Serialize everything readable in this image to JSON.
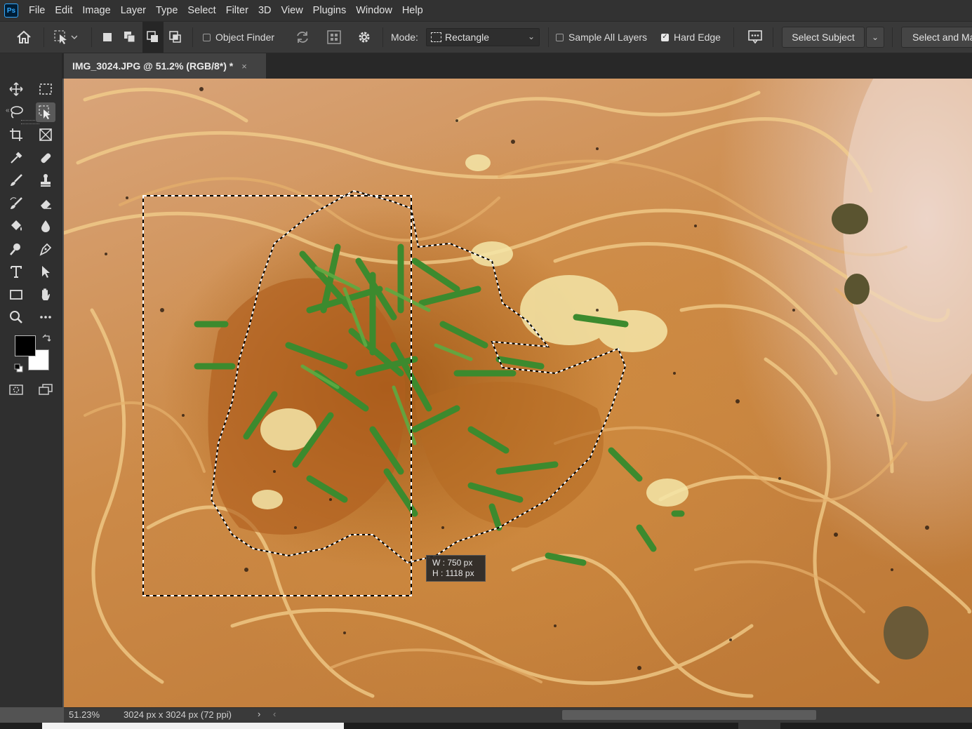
{
  "app": {
    "logo_text": "Ps",
    "menu": [
      "File",
      "Edit",
      "Image",
      "Layer",
      "Type",
      "Select",
      "Filter",
      "3D",
      "View",
      "Plugins",
      "Window",
      "Help"
    ]
  },
  "options_bar": {
    "object_finder": {
      "label": "Object Finder",
      "checked": false
    },
    "mode_label": "Mode:",
    "mode_value": "Rectangle",
    "sample_all_layers": {
      "label": "Sample All Layers",
      "checked": false
    },
    "hard_edge": {
      "label": "Hard Edge",
      "checked": true
    },
    "select_subject_label": "Select Subject",
    "select_and_mask_label": "Select and Ma"
  },
  "document": {
    "tab_title": "IMG_3024.JPG @ 51.2% (RGB/8*) *",
    "close_glyph": "×"
  },
  "selection_hint": {
    "width": "W :   750 px",
    "height": "H : 1118 px"
  },
  "status": {
    "zoom": "51.23%",
    "dimensions": "3024 px x 3024 px (72 ppi)",
    "arrow": "›",
    "left_arrow": "‹"
  },
  "colors": {
    "foreground": "#000000",
    "background": "#ffffff",
    "ui_dark": "#323232",
    "accent": "#31a8ff"
  },
  "tools": [
    "move-icon",
    "rectangular-marquee-icon",
    "lasso-icon",
    "object-selection-icon",
    "crop-icon",
    "frame-icon",
    "eyedropper-icon",
    "spot-healing-icon",
    "brush-icon",
    "clone-stamp-icon",
    "history-brush-icon",
    "eraser-icon",
    "paint-bucket-icon",
    "blur-icon",
    "dodge-icon",
    "pen-icon",
    "type-icon",
    "path-selection-icon",
    "rectangle-icon",
    "hand-icon",
    "zoom-icon",
    "more-tools-icon"
  ]
}
